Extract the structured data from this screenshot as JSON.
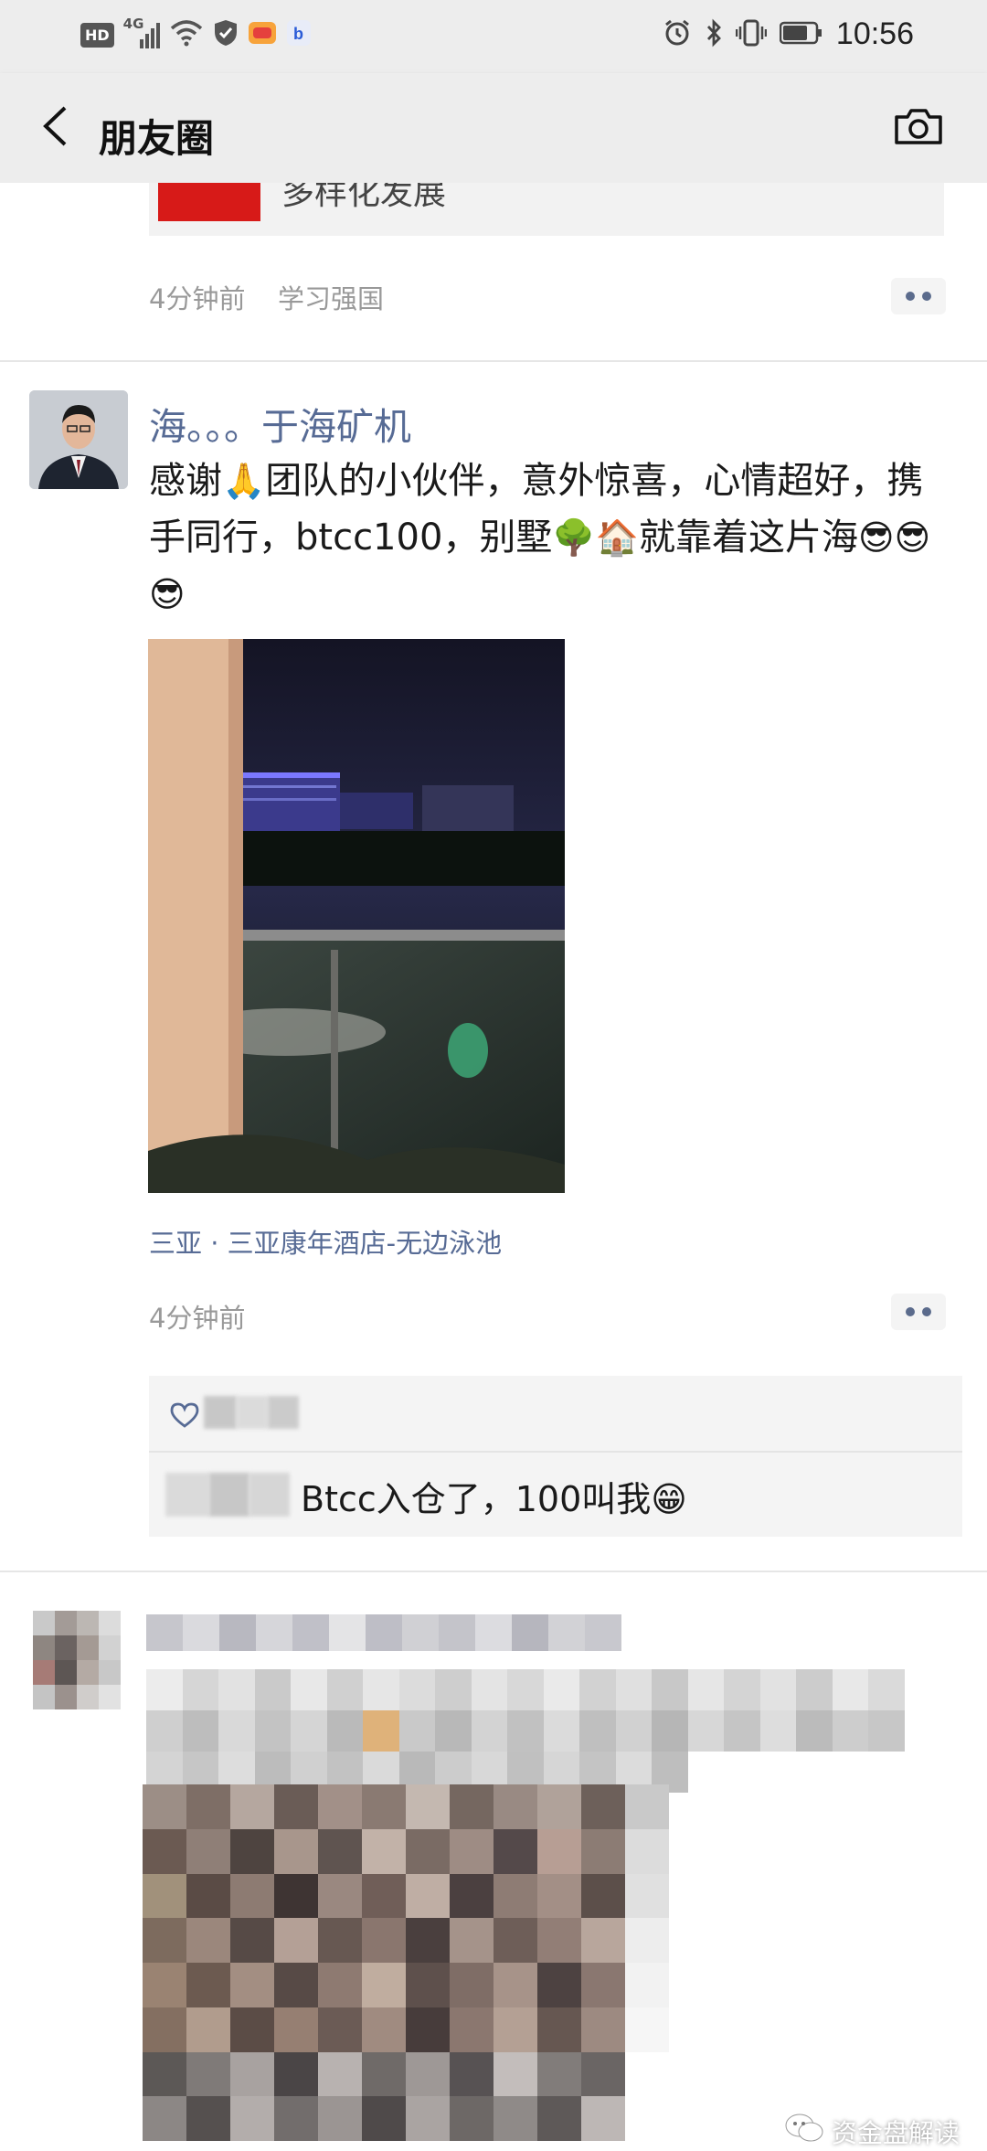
{
  "status_bar": {
    "network_labels": [
      "HD",
      "4G"
    ],
    "time": "10:56"
  },
  "header": {
    "title": "朋友圈",
    "back_icon": "chevron-left-icon",
    "camera_icon": "camera-icon"
  },
  "previous_post": {
    "share_text": "多样化发展",
    "time": "4分钟前",
    "source": "学习强国"
  },
  "main_post": {
    "author": "海。。。于海矿机",
    "text_parts": [
      "感谢",
      "🙏",
      "团队的小伙伴，意外惊喜，心情超好，携手同行，btcc100，别墅",
      "🌳🏠",
      "就靠着这片海",
      "😎😎😎"
    ],
    "location": "三亚 · 三亚康年酒店-无边泳池",
    "time": "4分钟前",
    "comment": "Btcc入仓了，100叫我",
    "comment_emoji": "😁"
  },
  "watermark": {
    "text": "资金盘解读"
  },
  "colors": {
    "link_blue": "#576b95",
    "header_bg": "#ededed",
    "time_gray": "#999999"
  }
}
